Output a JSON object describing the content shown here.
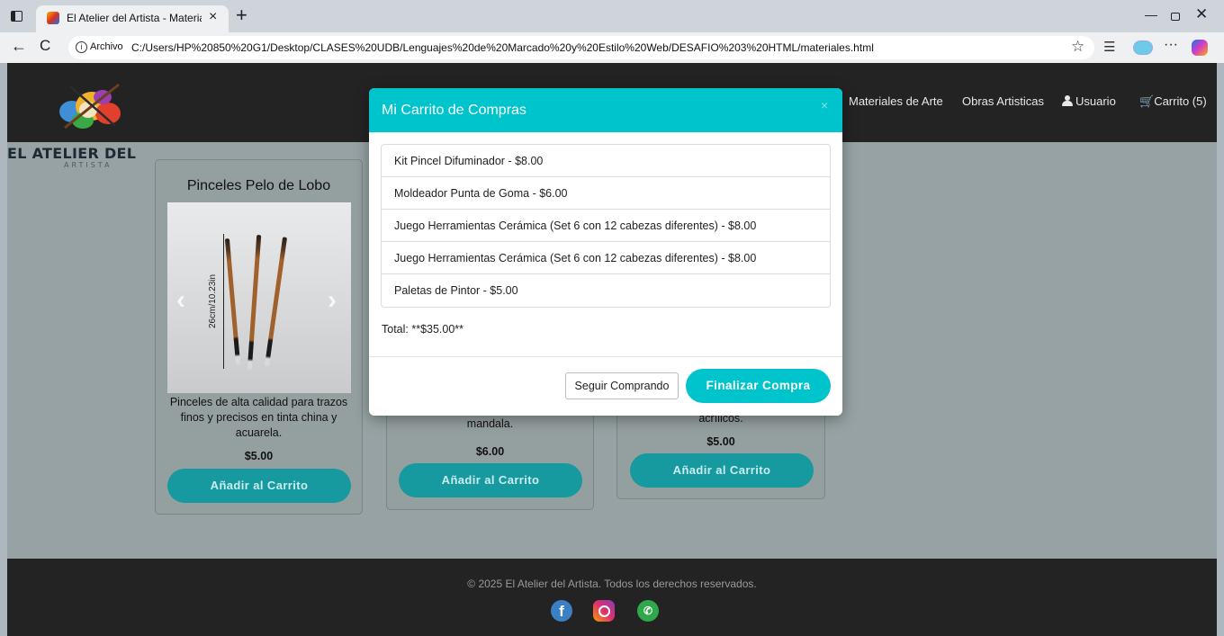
{
  "browser": {
    "tab_title": "El Atelier del Artista - Materiales d",
    "tab_close": "×",
    "new_tab": "+",
    "address_label": "Archivo",
    "url": "C:/Users/HP%20850%20G1/Desktop/CLASES%20UDB/Lenguajes%20de%20Marcado%20y%20Estilo%20Web/DESAFIO%203%20HTML/materiales.html",
    "back": "←",
    "reload": "C",
    "more": "···",
    "minimize": "—",
    "close": "✕"
  },
  "site": {
    "logo_line1": "EL ATELIER DEL",
    "logo_line2": "ARTISTA",
    "nav": {
      "materiales": "Materiales de Arte",
      "obras": "Obras Artisticas",
      "usuario": "Usuario",
      "carrito": "Carrito (5)"
    }
  },
  "products": [
    {
      "title": "Pinceles Pelo de Lobo",
      "image_caption": "26cm/10.23in",
      "description": "Pinceles de alta calidad para trazos finos y precisos en tinta china y acuarela.",
      "price": "$5.00",
      "button": "Añadir al Carrito"
    },
    {
      "description": "mandala.",
      "price": "$6.00",
      "button": "Añadir al Carrito"
    },
    {
      "description": "acrílicos.",
      "price": "$5.00",
      "button": "Añadir al Carrito"
    }
  ],
  "modal": {
    "title": "Mi Carrito de Compras",
    "close": "×",
    "items": [
      "Kit Pincel Difuminador - $8.00",
      "Moldeador Punta de Goma - $6.00",
      "Juego Herramientas Cerámica (Set 6 con 12 cabezas diferentes) - $8.00",
      "Juego Herramientas Cerámica (Set 6 con 12 cabezas diferentes) - $8.00",
      "Paletas de Pintor - $5.00"
    ],
    "total": "Total: **$35.00**",
    "continue_label": "Seguir Comprando",
    "checkout_label": "Finalizar Compra"
  },
  "footer": {
    "text": "© 2025 El Atelier del Artista. Todos los derechos reservados."
  },
  "colors": {
    "accent": "#00c4cc",
    "header_bg": "#232323",
    "button_dim": "#179a9f"
  }
}
